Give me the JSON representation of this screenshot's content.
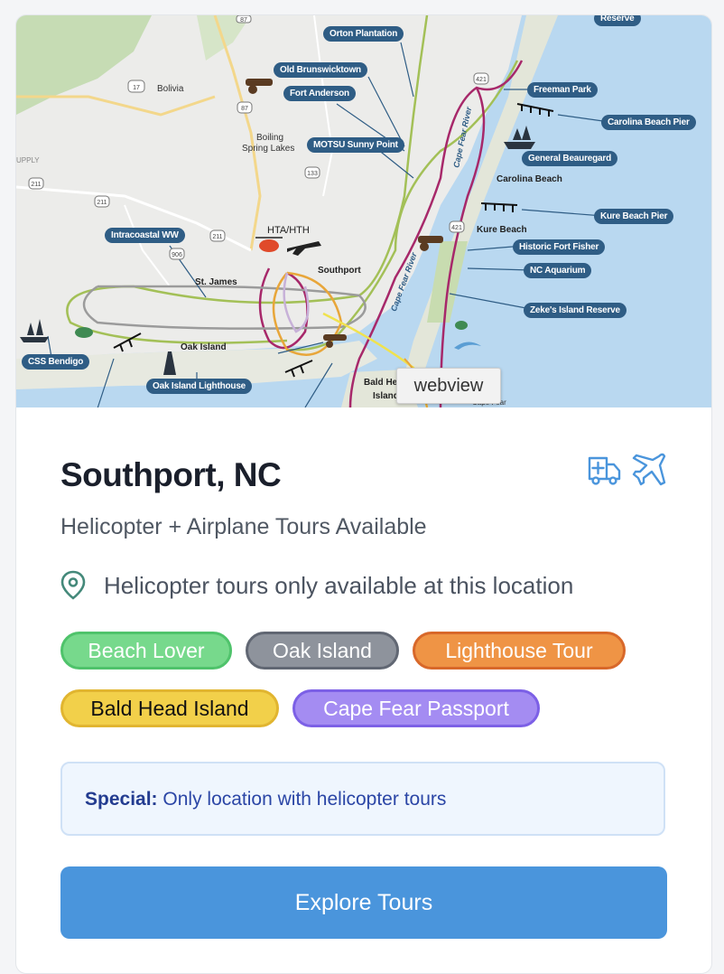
{
  "map": {
    "alt": "webview",
    "tooltip": "webview",
    "labels": {
      "reserve": "Reserve",
      "orton": "Orton Plantation",
      "old_brunswick": "Old Brunswicktown",
      "fort_anderson": "Fort Anderson",
      "motsu": "MOTSU Sunny Point",
      "intracoastal": "Intracoastal WW",
      "freeman": "Freeman Park",
      "carolina_pier": "Carolina Beach Pier",
      "general": "General Beauregard",
      "kure_pier": "Kure Beach Pier",
      "fort_fisher": "Historic Fort Fisher",
      "nc_aquarium": "NC Aquarium",
      "zekes": "Zeke's Island Reserve",
      "css": "CSS Bendigo",
      "oak_lighthouse": "Oak Island Lighthouse"
    },
    "places": {
      "bolivia": "Bolivia",
      "boiling": "Boiling",
      "spring_lakes": "Spring Lakes",
      "upply": "UPPLY",
      "carolina_beach": "Carolina Beach",
      "kure_beach": "Kure Beach",
      "southport": "Southport",
      "hta": "HTA/HTH",
      "st_james": "St. James",
      "oak_island": "Oak Island",
      "bald_head": "Bald He",
      "island": "Island",
      "cape_fear_river": "Cape Fear River",
      "cape_fear_river2": "Cape Fear River",
      "cape_fear": "Cape Fear"
    },
    "routes": [
      "17",
      "87",
      "133",
      "211",
      "211",
      "211",
      "906",
      "421",
      "421",
      "87"
    ]
  },
  "location": {
    "title": "Southport, NC",
    "subtitle": "Helicopter + Airplane Tours Available",
    "note": "Helicopter tours only available at this location",
    "icons": [
      "ambulance-icon",
      "airplane-icon"
    ],
    "icon_color": "#4a95dc"
  },
  "tags": [
    {
      "label": "Beach Lover",
      "bg": "#77d98c",
      "border": "#4fc36b",
      "color": "#ffffff"
    },
    {
      "label": "Oak Island",
      "bg": "#8e939c",
      "border": "#616773",
      "color": "#ffffff"
    },
    {
      "label": "Lighthouse Tour",
      "bg": "#ef9445",
      "border": "#d8682a",
      "color": "#ffffff"
    },
    {
      "label": "Bald Head Island",
      "bg": "#f2d04a",
      "border": "#e1b530",
      "color": "#111111"
    },
    {
      "label": "Cape Fear Passport",
      "bg": "#a48cf2",
      "border": "#7c60e6",
      "color": "#ffffff"
    }
  ],
  "special": {
    "label": "Special:",
    "text": "Only location with helicopter tours"
  },
  "cta": {
    "label": "Explore Tours",
    "color": "#4a95dc"
  }
}
